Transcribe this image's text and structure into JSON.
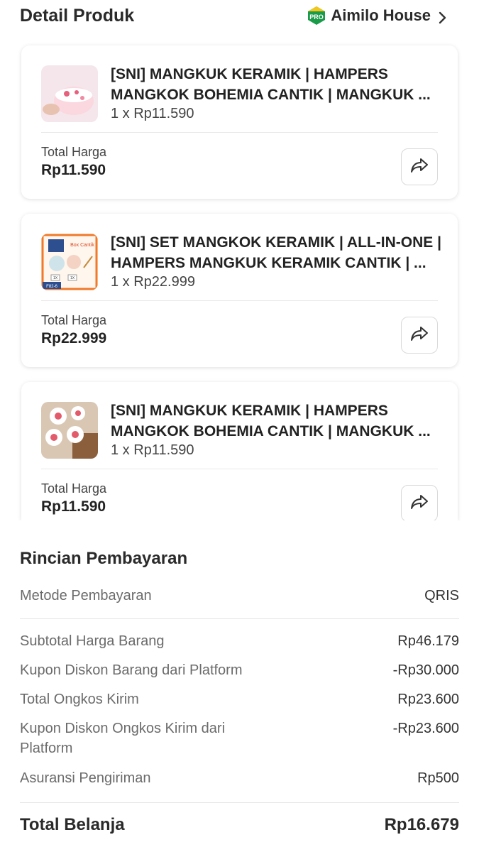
{
  "header": {
    "title": "Detail Produk",
    "shop_badge": "PRO",
    "shop_name": "Aimilo House",
    "chevron_icon": "chevron-right-icon"
  },
  "products": [
    {
      "name": "[SNI] MANGKUK KERAMIK | HAMPERS MANGKOK BOHEMIA CANTIK | MANGKUK ...",
      "qty_price": "1 x Rp11.590",
      "total_label": "Total Harga",
      "total_value": "Rp11.590",
      "share_icon": "share-icon"
    },
    {
      "name": "[SNI] SET MANGKOK KERAMIK | ALL-IN-ONE | HAMPERS MANGKUK KERAMIK CANTIK | ...",
      "qty_price": "1 x Rp22.999",
      "total_label": "Total Harga",
      "total_value": "Rp22.999",
      "share_icon": "share-icon",
      "thumb_text": [
        "Box Cantik",
        "1X",
        "1X",
        "F82-6"
      ]
    },
    {
      "name": "[SNI] MANGKUK KERAMIK | HAMPERS MANGKOK BOHEMIA CANTIK | MANGKUK ...",
      "qty_price": "1 x Rp11.590",
      "total_label": "Total Harga",
      "total_value": "Rp11.590",
      "share_icon": "share-icon"
    }
  ],
  "payment": {
    "title": "Rincian Pembayaran",
    "method_label": "Metode Pembayaran",
    "method_value": "QRIS",
    "rows": [
      {
        "label": "Subtotal Harga Barang",
        "value": "Rp46.179"
      },
      {
        "label": "Kupon Diskon Barang dari Platform",
        "value": "-Rp30.000"
      },
      {
        "label": "Total Ongkos Kirim",
        "value": "Rp23.600"
      },
      {
        "label": "Kupon Diskon Ongkos Kirim dari Platform",
        "value": "-Rp23.600"
      },
      {
        "label": "Asuransi Pengiriman",
        "value": "Rp500"
      }
    ],
    "grand_label": "Total Belanja",
    "grand_value": "Rp16.679"
  },
  "colors": {
    "pro_badge_green": "#1a9b4a",
    "pro_badge_yellow": "#f5c518",
    "text_dark": "#2a2a2a",
    "text_muted": "#6b6b6b"
  }
}
